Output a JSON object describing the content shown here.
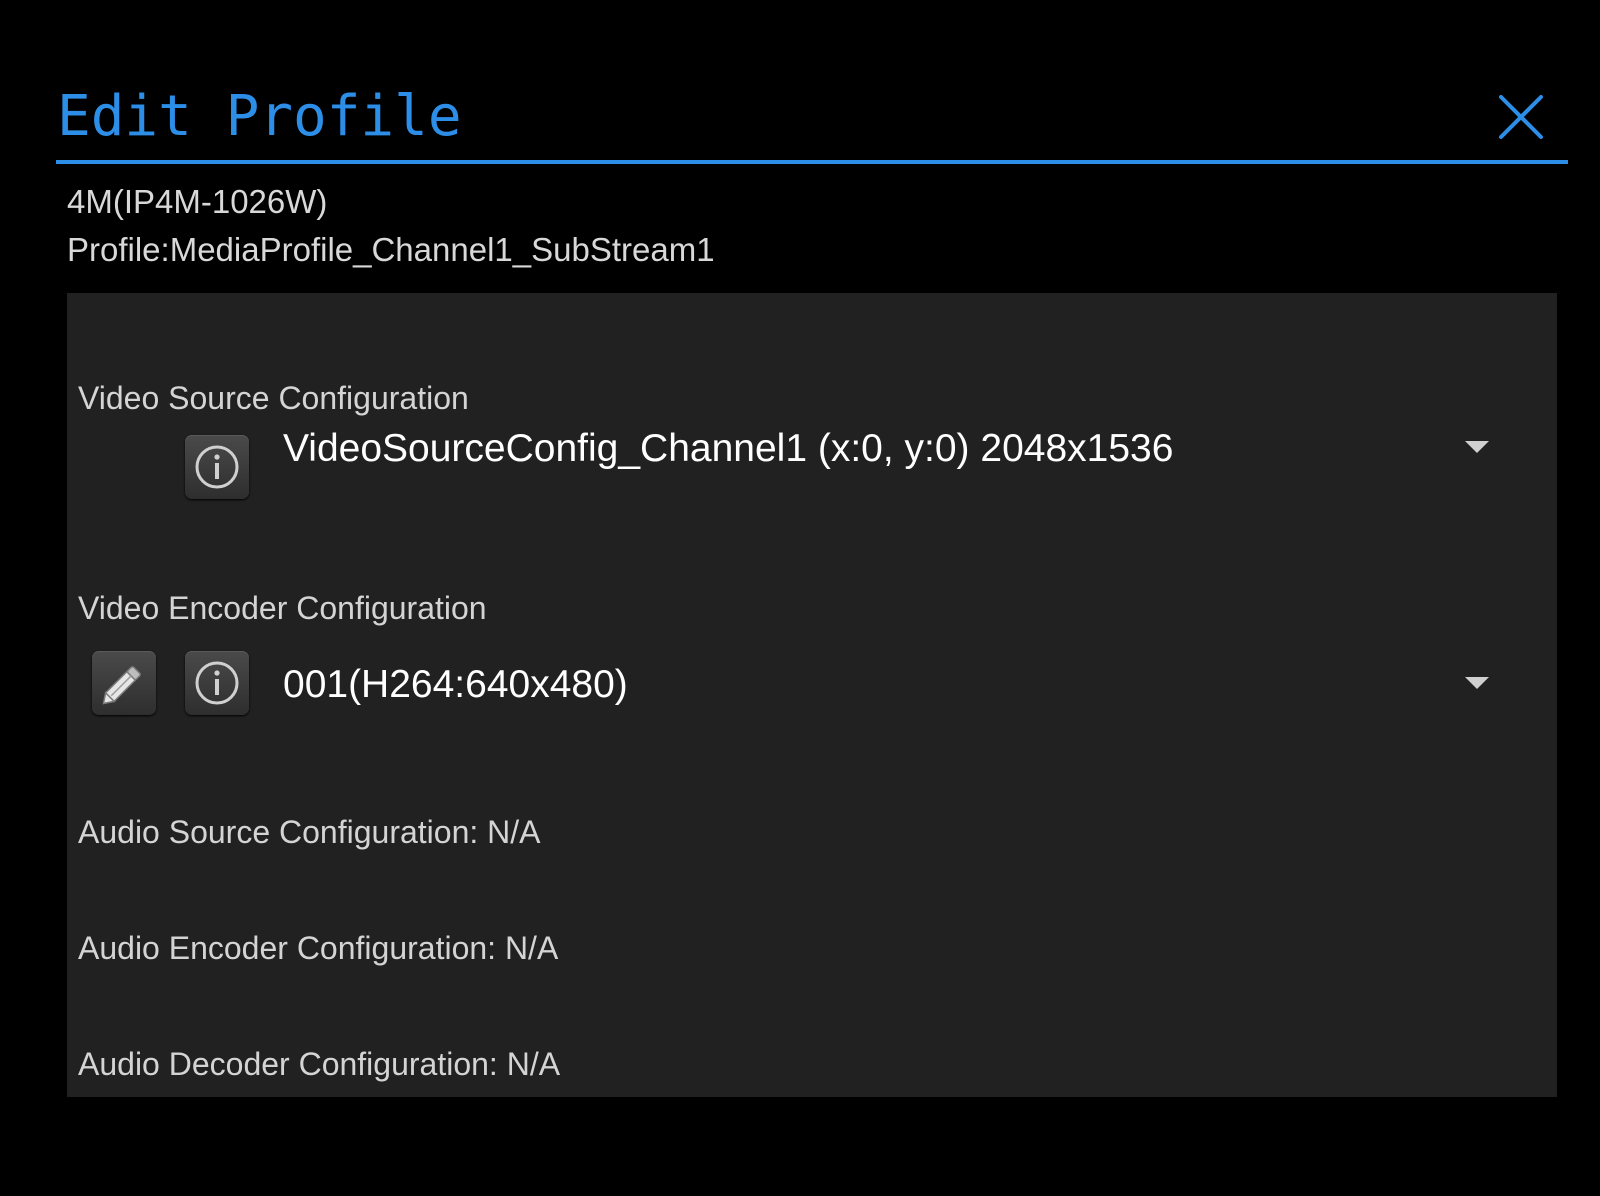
{
  "dialog": {
    "title": "Edit Profile",
    "close_icon": "close-icon",
    "accent_color": "#2d8ee8"
  },
  "device": {
    "name": "4M(IP4M-1026W)",
    "profile": "Profile:MediaProfile_Channel1_SubStream1"
  },
  "video_source": {
    "label": "Video Source Configuration",
    "selected": "VideoSourceConfig_Channel1 (x:0, y:0) 2048x1536",
    "info_icon": "info-icon",
    "dropdown_icon": "dropdown-arrow-icon"
  },
  "video_encoder": {
    "label": "Video Encoder Configuration",
    "selected": "001(H264:640x480)",
    "edit_icon": "pencil-icon",
    "info_icon": "info-icon",
    "dropdown_icon": "dropdown-arrow-icon"
  },
  "audio_source": {
    "label": "Audio Source Configuration: N/A"
  },
  "audio_encoder": {
    "label": "Audio Encoder Configuration: N/A"
  },
  "audio_decoder": {
    "label": "Audio Decoder Configuration: N/A"
  }
}
